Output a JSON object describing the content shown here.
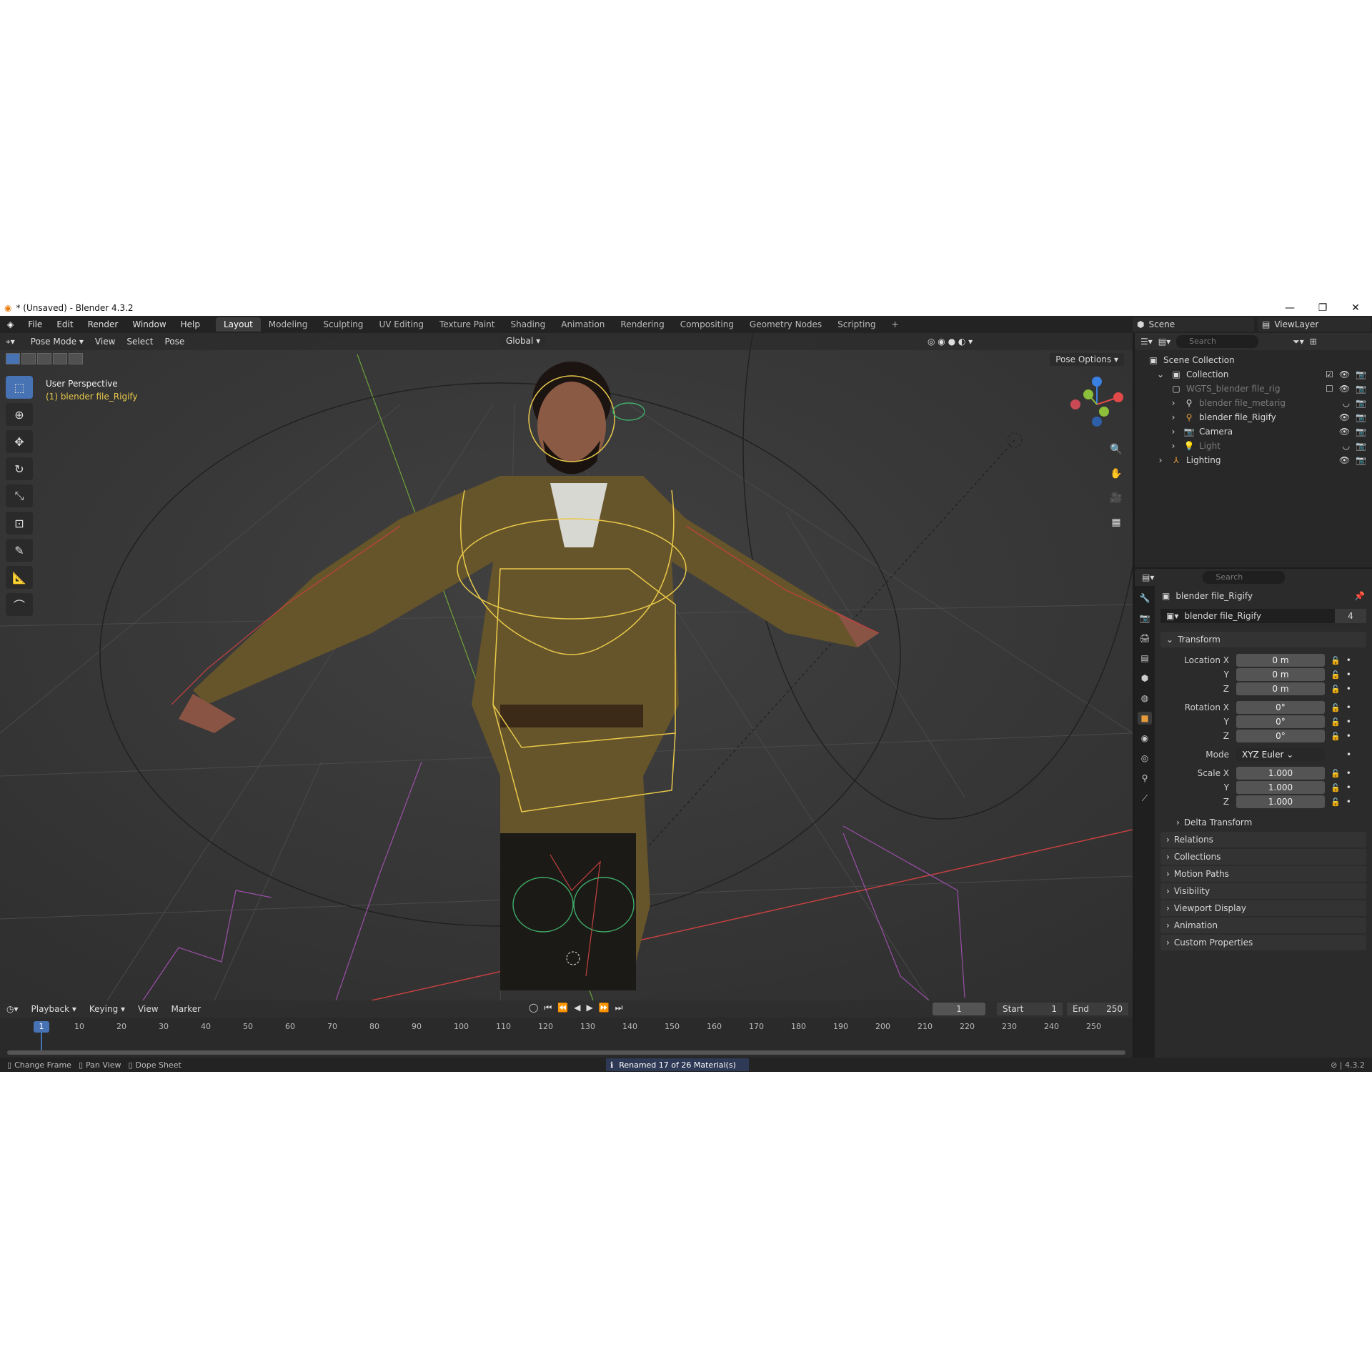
{
  "window": {
    "title": "* (Unsaved) - Blender 4.3.2",
    "min": "—",
    "restore": "❐",
    "close": "✕"
  },
  "menu": [
    "File",
    "Edit",
    "Render",
    "Window",
    "Help"
  ],
  "workspaces": [
    "Layout",
    "Modeling",
    "Sculpting",
    "UV Editing",
    "Texture Paint",
    "Shading",
    "Animation",
    "Rendering",
    "Compositing",
    "Geometry Nodes",
    "Scripting",
    "+"
  ],
  "scene": {
    "label": "Scene",
    "view_layer": "ViewLayer"
  },
  "viewport": {
    "mode": "Pose Mode",
    "menus": [
      "View",
      "Select",
      "Pose"
    ],
    "orientation": "Global",
    "pose_options": "Pose Options",
    "info_line1": "User Perspective",
    "info_line2": "(1) blender file_Rigify"
  },
  "outliner": {
    "search_placeholder": "Search",
    "rows": [
      {
        "label": "Scene Collection",
        "indent": 0,
        "dim": false
      },
      {
        "label": "Collection",
        "indent": 1,
        "dim": false
      },
      {
        "label": "WGTS_blender file_rig",
        "indent": 2,
        "dim": true
      },
      {
        "label": "blender file_metarig",
        "indent": 2,
        "dim": true
      },
      {
        "label": "blender file_Rigify",
        "indent": 2,
        "dim": false
      },
      {
        "label": "Camera",
        "indent": 2,
        "dim": false
      },
      {
        "label": "Light",
        "indent": 2,
        "dim": true
      },
      {
        "label": "Lighting",
        "indent": 1,
        "dim": false
      }
    ]
  },
  "properties": {
    "search_placeholder": "Search",
    "object_name": "blender file_Rigify",
    "data_name": "blender file_Rigify",
    "users": "4",
    "transform_label": "Transform",
    "location": {
      "label": "Location X",
      "x": "0 m",
      "y": "0 m",
      "z": "0 m"
    },
    "rotation": {
      "label": "Rotation X",
      "x": "0°",
      "y": "0°",
      "z": "0°"
    },
    "mode": {
      "label": "Mode",
      "value": "XYZ Euler"
    },
    "scale": {
      "label": "Scale X",
      "x": "1.000",
      "y": "1.000",
      "z": "1.000"
    },
    "axis_y": "Y",
    "axis_z": "Z",
    "delta": "Delta Transform",
    "panels": [
      "Relations",
      "Collections",
      "Motion Paths",
      "Visibility",
      "Viewport Display",
      "Animation",
      "Custom Properties"
    ]
  },
  "timeline": {
    "menus": [
      "Playback",
      "Keying",
      "View",
      "Marker"
    ],
    "current_frame": "1",
    "start_label": "Start",
    "start": "1",
    "end_label": "End",
    "end": "250",
    "ruler": [
      "10",
      "20",
      "30",
      "40",
      "50",
      "60",
      "70",
      "80",
      "90",
      "100",
      "110",
      "120",
      "130",
      "140",
      "150",
      "160",
      "170",
      "180",
      "190",
      "200",
      "210",
      "220",
      "230",
      "240",
      "250"
    ]
  },
  "statusbar": {
    "change_frame": "Change Frame",
    "pan_view": "Pan View",
    "dope_sheet": "Dope Sheet",
    "message": "Renamed 17 of 26 Material(s)",
    "version": "4.3.2"
  },
  "colors": {
    "accent": "#4772b3",
    "selected_rig": "#e8c84a",
    "x_axis": "#e24a4a",
    "y_axis": "#8cbf3a",
    "z_axis": "#3a7fe2"
  }
}
